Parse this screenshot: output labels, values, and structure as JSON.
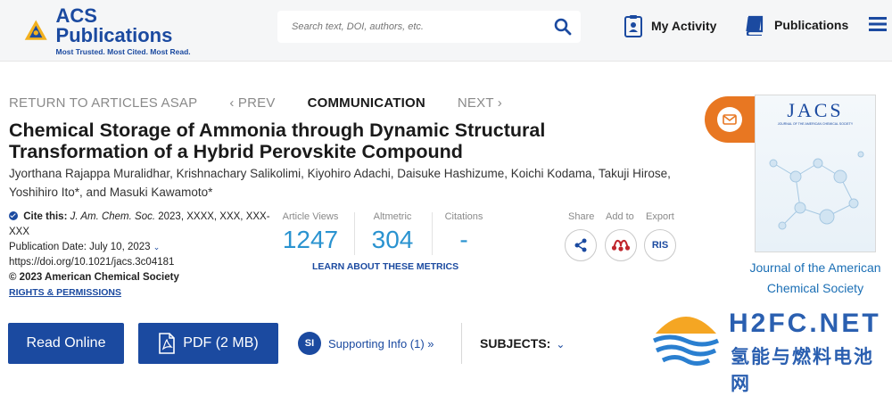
{
  "header": {
    "logo_title": "ACS Publications",
    "logo_tagline": "Most Trusted. Most Cited. Most Read.",
    "search_placeholder": "Search text, DOI, authors, etc.",
    "my_activity": "My Activity",
    "publications": "Publications"
  },
  "article_nav": {
    "return": "RETURN TO ARTICLES ASAP",
    "prev": "‹ PREV",
    "type": "COMMUNICATION",
    "next": "NEXT ›"
  },
  "article": {
    "title_line1": "Chemical Storage of Ammonia through Dynamic Structural",
    "title_line2": "Transformation of a Hybrid Perovskite Compound",
    "authors_line1": "Jyorthana Rajappa Muralidhar, Krishnachary Salikolimi, Kiyohiro Adachi, Daisuke Hashizume, Koichi Kodama, Takuji Hirose,",
    "authors_line2": "Yoshihiro Ito*, and Masuki Kawamoto*"
  },
  "citation": {
    "cite_label": "Cite this:",
    "journal": "J. Am. Chem. Soc.",
    "ref": "2023, XXXX, XXX, XXX-",
    "ref_cont": "XXX",
    "pub_date": "Publication Date: July 10, 2023",
    "doi": "https://doi.org/10.1021/jacs.3c04181",
    "copyright": "© 2023 American Chemical Society",
    "rights": "RIGHTS & PERMISSIONS"
  },
  "metrics": {
    "views_label": "Article Views",
    "views": "1247",
    "altmetric_label": "Altmetric",
    "altmetric": "304",
    "citations_label": "Citations",
    "citations": "-",
    "learn": "LEARN ABOUT THESE METRICS"
  },
  "tools": {
    "share": "Share",
    "add_to": "Add to",
    "export": "Export",
    "ris": "RIS"
  },
  "actions": {
    "read_online": "Read Online",
    "pdf": "PDF (2 MB)",
    "si_badge": "SI",
    "supporting_info": "Supporting Info (1) »",
    "subjects": "SUBJECTS:"
  },
  "sidebar": {
    "cover_title": "JACS",
    "cover_subtitle": "JOURNAL OF THE AMERICAN CHEMICAL SOCIETY",
    "journal_line1": "Journal of the American",
    "journal_line2": "Chemical Society"
  },
  "watermark": {
    "main": "H2FC.NET",
    "sub": "氢能与燃料电池网"
  },
  "colors": {
    "brand_blue": "#1b4aa0",
    "metric_blue": "#2a93d0",
    "email_orange": "#e87722"
  }
}
